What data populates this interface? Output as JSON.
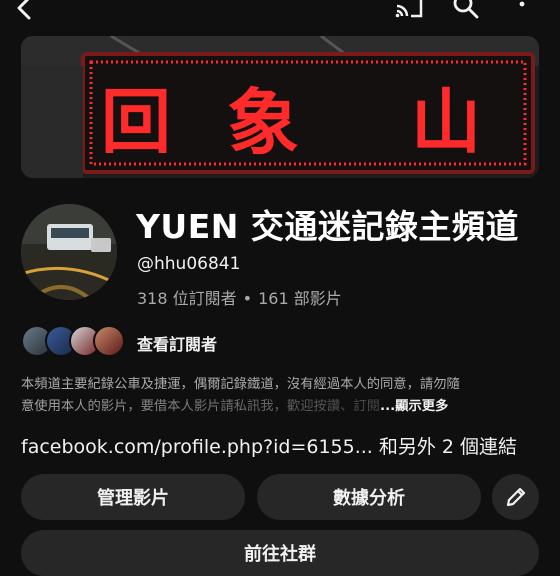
{
  "topbar": {
    "back_icon": "chevron-left-icon",
    "cast_icon": "cast-icon",
    "search_icon": "search-icon",
    "more_icon": "more-vertical-icon"
  },
  "banner": {
    "led_text": [
      "回",
      "象",
      "山"
    ],
    "led_color": "#ff2a2a"
  },
  "channel": {
    "title": "YUEN 交通迷記錄主頻道",
    "handle": "@hhu06841",
    "subscribers": "318 位訂閱者",
    "separator": "•",
    "videos": "161 部影片"
  },
  "subscribers_row": {
    "label": "查看訂閱者"
  },
  "description": {
    "line1": "本頻道主要紀錄公車及捷運，偶爾記錄鐵道，沒有經過本人的同意，請勿隨",
    "line2": "意使用本人的影片，要借本人影片請私訊我，歡迎按讚、訂閱",
    "more_label": "...顯示更多"
  },
  "links": {
    "primary": "facebook.com/profile.php?id=6155...",
    "extra": " 和另外 2 個連結"
  },
  "buttons": {
    "manage_videos": "管理影片",
    "analytics": "數據分析",
    "edit_icon": "pencil-icon",
    "community": "前往社群"
  },
  "colors": {
    "background": "#0f0f0f",
    "button_bg": "#272727",
    "secondary_text": "#aaaaaa"
  }
}
